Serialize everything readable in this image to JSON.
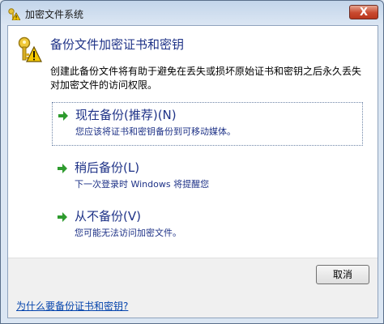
{
  "window": {
    "title": "加密文件系统",
    "close_glyph": "X"
  },
  "header": {
    "heading": "备份文件加密证书和密钥",
    "description": "创建此备份文件将有助于避免在丢失或损坏原始证书和密钥之后永久丢失对加密文件的访问权限。",
    "icon": "key-warning-icon"
  },
  "commands": [
    {
      "title": "现在备份(推荐)(N)",
      "subtitle": "您应该将证书和密钥备份到可移动媒体。"
    },
    {
      "title": "稍后备份(L)",
      "subtitle": "下一次登录时 Windows 将提醒您"
    },
    {
      "title": "从不备份(V)",
      "subtitle": "您可能无法访问加密文件。"
    }
  ],
  "buttons": {
    "cancel": "取消"
  },
  "footer": {
    "help_link": "为什么要备份证书和密钥?"
  },
  "colors": {
    "accent": "#1e3287",
    "arrow": "#2e9b2e",
    "link": "#0645ad"
  }
}
